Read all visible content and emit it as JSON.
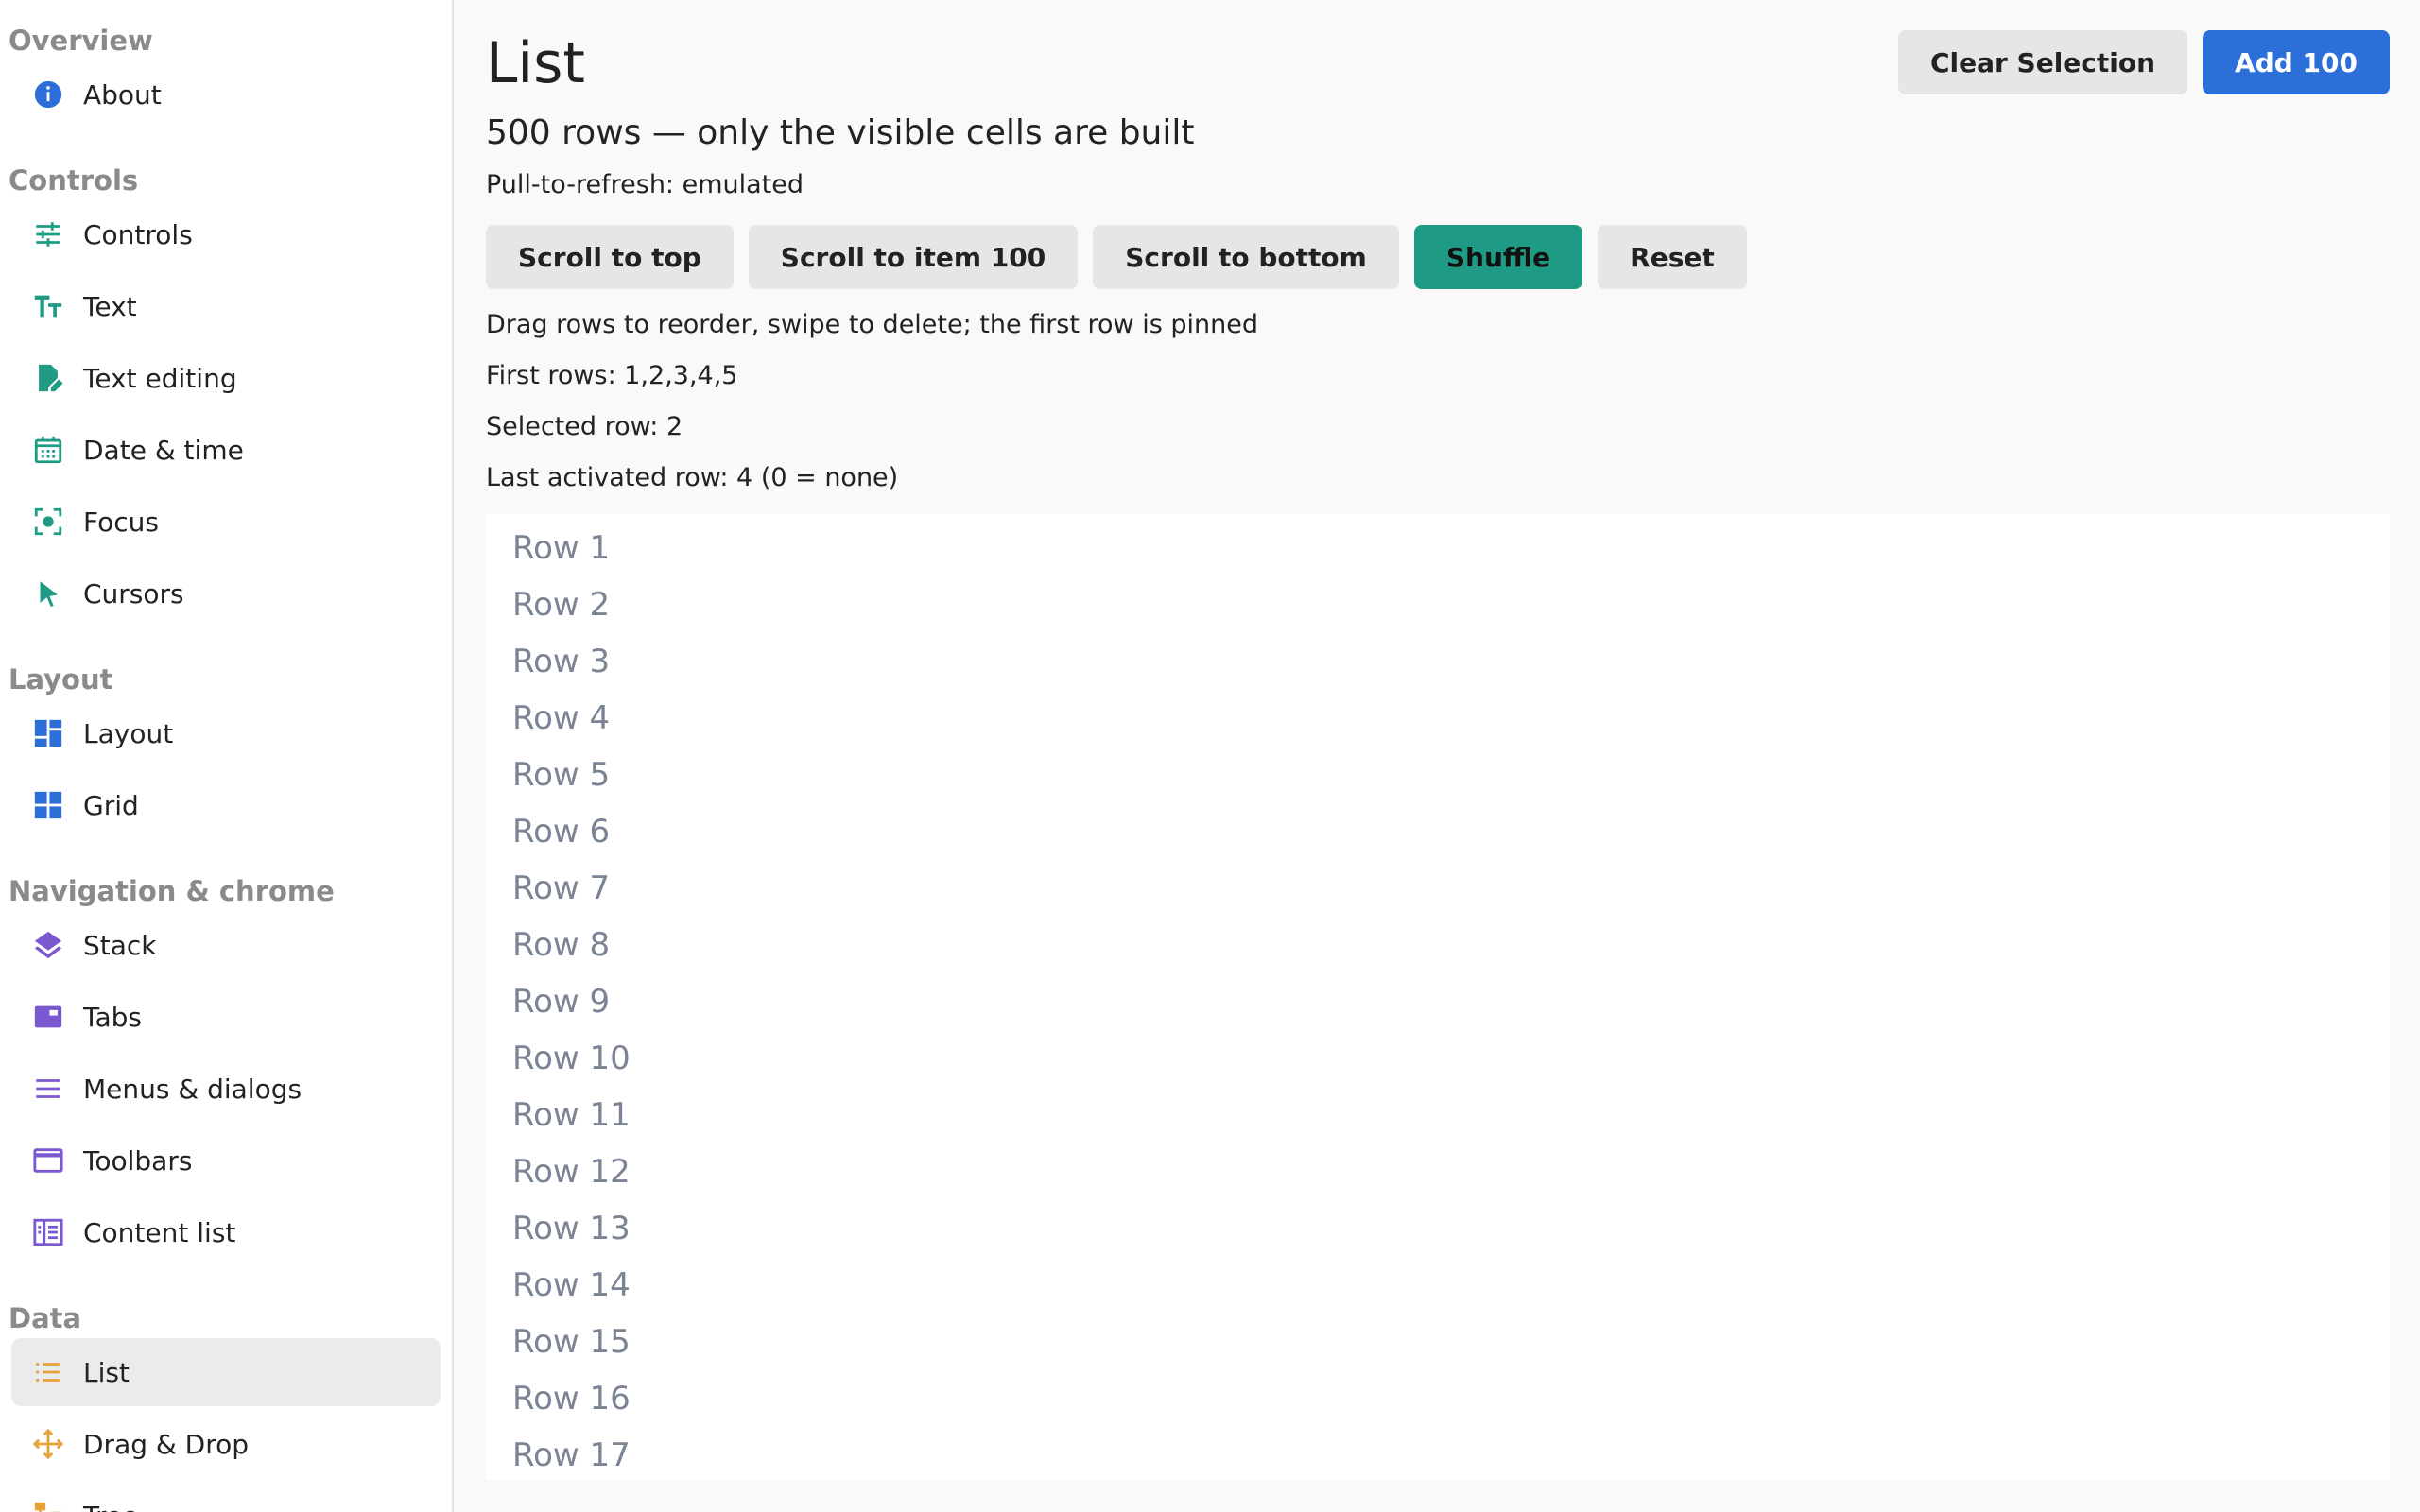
{
  "sidebar": {
    "sections": [
      {
        "title": "Overview",
        "items": [
          {
            "label": "About",
            "icon": "info-icon",
            "color": "#2d6fd8"
          }
        ]
      },
      {
        "title": "Controls",
        "items": [
          {
            "label": "Controls",
            "icon": "sliders-icon",
            "color": "#1f9b85"
          },
          {
            "label": "Text",
            "icon": "text-size-icon",
            "color": "#1f9b85"
          },
          {
            "label": "Text editing",
            "icon": "edit-document-icon",
            "color": "#1f9b85"
          },
          {
            "label": "Date & time",
            "icon": "calendar-icon",
            "color": "#1f9b85"
          },
          {
            "label": "Focus",
            "icon": "focus-icon",
            "color": "#1f9b85"
          },
          {
            "label": "Cursors",
            "icon": "cursor-icon",
            "color": "#1f9b85"
          }
        ]
      },
      {
        "title": "Layout",
        "items": [
          {
            "label": "Layout",
            "icon": "dashboard-icon",
            "color": "#2d6fd8"
          },
          {
            "label": "Grid",
            "icon": "grid-icon",
            "color": "#2d6fd8"
          }
        ]
      },
      {
        "title": "Navigation & chrome",
        "items": [
          {
            "label": "Stack",
            "icon": "layers-icon",
            "color": "#7b57d0"
          },
          {
            "label": "Tabs",
            "icon": "tabs-icon",
            "color": "#7b57d0"
          },
          {
            "label": "Menus & dialogs",
            "icon": "menu-icon",
            "color": "#7b57d0"
          },
          {
            "label": "Toolbars",
            "icon": "window-icon",
            "color": "#7b57d0"
          },
          {
            "label": "Content list",
            "icon": "content-list-icon",
            "color": "#7b57d0"
          }
        ]
      },
      {
        "title": "Data",
        "items": [
          {
            "label": "List",
            "icon": "list-icon",
            "color": "#e8a23a",
            "active": true
          },
          {
            "label": "Drag & Drop",
            "icon": "move-icon",
            "color": "#e8a23a"
          },
          {
            "label": "Tree",
            "icon": "tree-icon",
            "color": "#e8a23a"
          }
        ]
      }
    ]
  },
  "main": {
    "title": "List",
    "clear_selection_label": "Clear Selection",
    "add_label": "Add 100",
    "subtitle": "500 rows — only the visible cells are built",
    "pull_to_refresh": "Pull-to-refresh: emulated",
    "buttons": {
      "scroll_top": "Scroll to top",
      "scroll_item": "Scroll to item 100",
      "scroll_bottom": "Scroll to bottom",
      "shuffle": "Shuffle",
      "reset": "Reset"
    },
    "hint": "Drag rows to reorder, swipe to delete; the first row is pinned",
    "first_rows": "First rows: 1,2,3,4,5",
    "selected_row": "Selected row: 2",
    "last_activated": "Last activated row: 4 (0 = none)",
    "rows": [
      "Row 1",
      "Row 2",
      "Row 3",
      "Row 4",
      "Row 5",
      "Row 6",
      "Row 7",
      "Row 8",
      "Row 9",
      "Row 10",
      "Row 11",
      "Row 12",
      "Row 13",
      "Row 14",
      "Row 15",
      "Row 16",
      "Row 17"
    ]
  },
  "colors": {
    "primary": "#2d6fd8",
    "teal": "#1f9b85",
    "purple": "#7b57d0",
    "orange": "#e8a23a",
    "row_text": "#7b8494"
  }
}
